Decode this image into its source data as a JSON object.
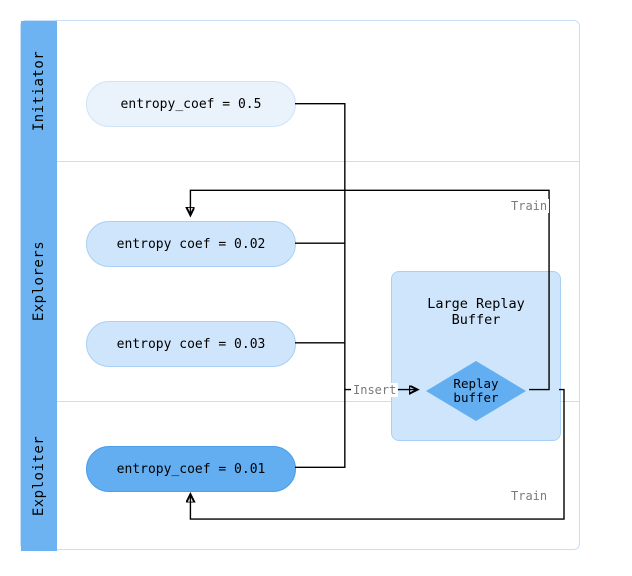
{
  "sections": {
    "initiator": {
      "label": "Initiator"
    },
    "explorers": {
      "label": "Explorers"
    },
    "exploiter": {
      "label": "Exploiter"
    }
  },
  "nodes": {
    "initiator_node": {
      "label": "entropy_coef = 0.5"
    },
    "explorer_node_1": {
      "label": "entropy coef = 0.02"
    },
    "explorer_node_2": {
      "label": "entropy coef = 0.03"
    },
    "exploiter_node": {
      "label": "entropy_coef = 0.01"
    },
    "buffer_box": {
      "title_l1": "Large Replay",
      "title_l2": "Buffer"
    },
    "buffer_diamond": {
      "label_l1": "Replay",
      "label_l2": "buffer"
    }
  },
  "edges": {
    "insert": {
      "label": "Insert"
    },
    "train_top": {
      "label": "Train"
    },
    "train_bottom": {
      "label": "Train"
    }
  }
}
